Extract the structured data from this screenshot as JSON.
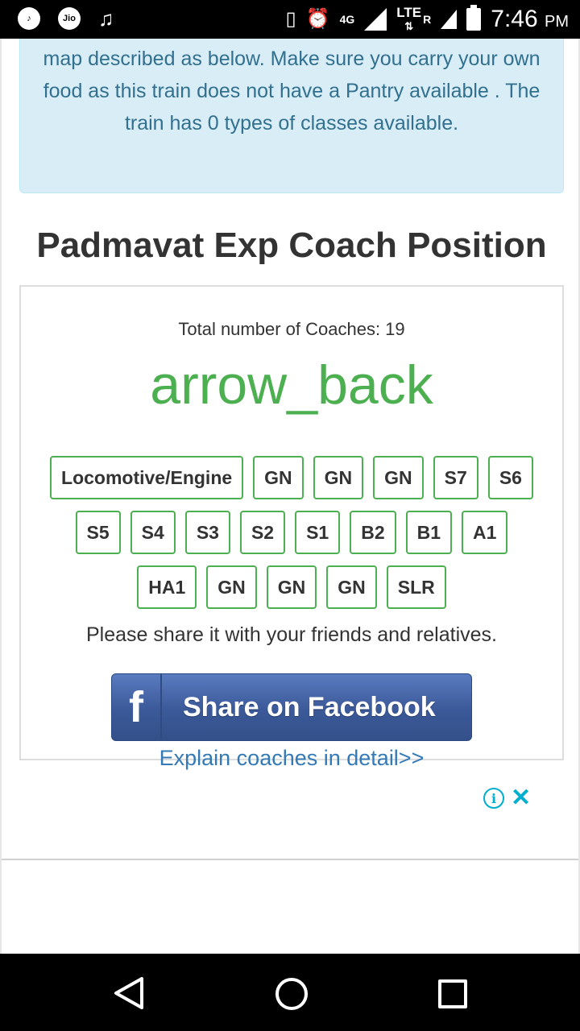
{
  "status_bar": {
    "jio_label": "Jio",
    "network_4g": "4G",
    "network_lte": "LTE",
    "roaming": "R",
    "time": "7:46",
    "ampm": "PM"
  },
  "info_box": {
    "text": "map described as below. Make sure you carry your own food as this train does not have a Pantry available . The train has 0 types of classes available."
  },
  "page": {
    "heading": "Padmavat Exp Coach Position"
  },
  "coach_card": {
    "total_label": "Total number of Coaches: 19",
    "direction_icon_text": "arrow_back",
    "rows": [
      [
        "Locomotive/Engine",
        "GN",
        "GN",
        "GN",
        "S7",
        "S6"
      ],
      [
        "S5",
        "S4",
        "S3",
        "S2",
        "S1",
        "B2",
        "B1",
        "A1"
      ],
      [
        "HA1",
        "GN",
        "GN",
        "GN",
        "SLR"
      ]
    ],
    "share_text": "Please share it with your friends and relatives.",
    "facebook_button": "Share on Facebook",
    "facebook_glyph": "f",
    "explain_link": "Explain coaches in detail>>"
  },
  "ad": {
    "info_glyph": "i",
    "close_glyph": "✕"
  },
  "colors": {
    "accent_green": "#4caf50",
    "info_bg": "#d9edf7",
    "info_text": "#31708f",
    "link_blue": "#337ab7",
    "facebook_blue": "#3b5998"
  }
}
